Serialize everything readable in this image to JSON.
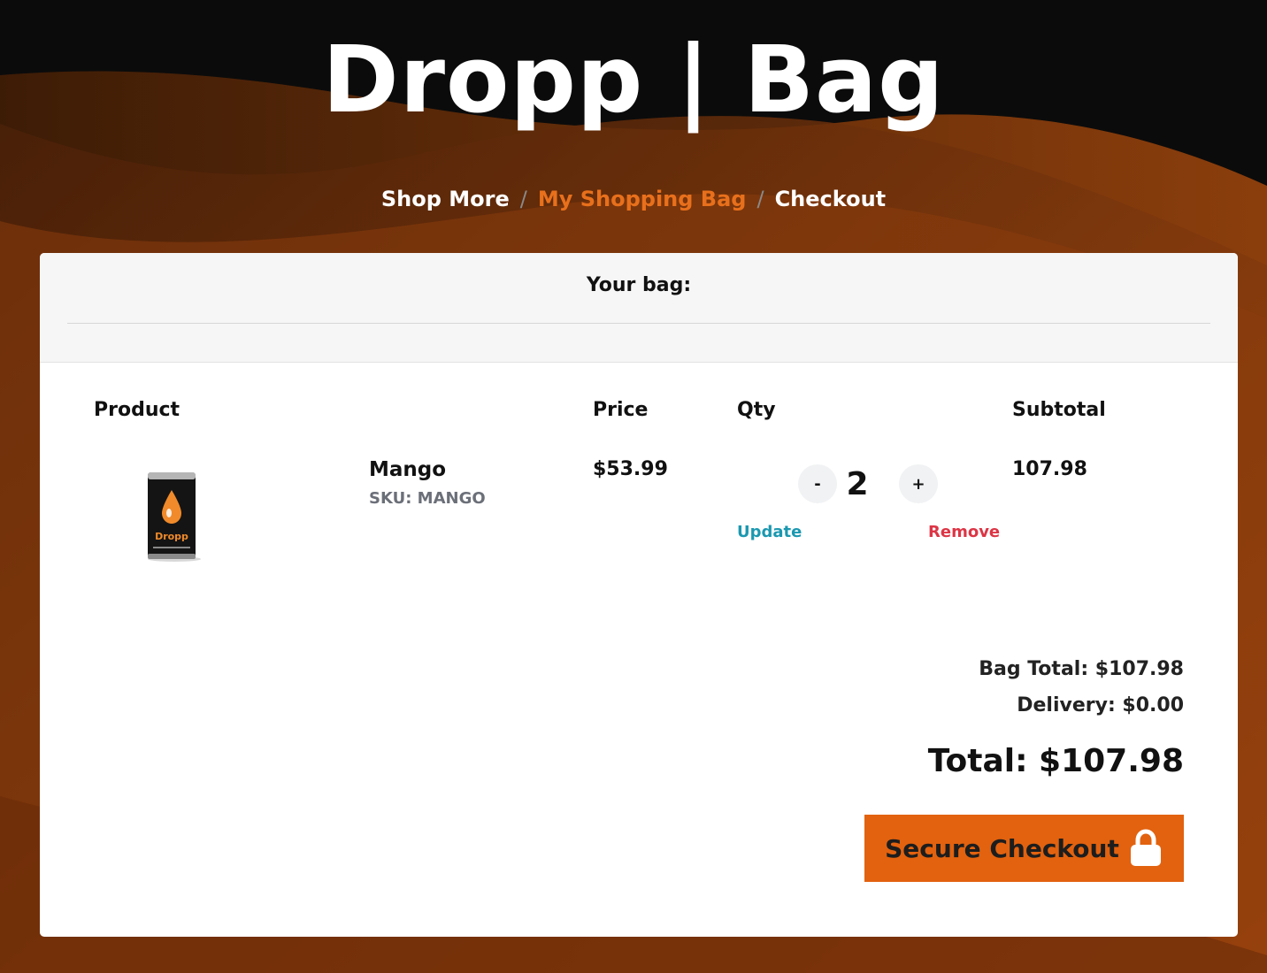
{
  "header": {
    "title": "Dropp | Bag"
  },
  "breadcrumb": {
    "items": [
      {
        "label": "Shop More",
        "active": false
      },
      {
        "label": "My Shopping Bag",
        "active": true
      },
      {
        "label": "Checkout",
        "active": false
      }
    ],
    "separator": "/"
  },
  "bag": {
    "heading": "Your bag:",
    "columns": {
      "product": "Product",
      "price": "Price",
      "qty": "Qty",
      "subtotal": "Subtotal"
    },
    "items": [
      {
        "name": "Mango",
        "sku": "SKU: MANGO",
        "image_brand_text": "Dropp",
        "price": "$53.99",
        "qty": "2",
        "decrease_label": "-",
        "increase_label": "+",
        "update_label": "Update",
        "remove_label": "Remove",
        "subtotal": "107.98"
      }
    ]
  },
  "totals": {
    "bag_total": "Bag Total: $107.98",
    "delivery": "Delivery: $0.00",
    "total": "Total: $107.98"
  },
  "checkout": {
    "label": "Secure Checkout",
    "icon": "lock-icon"
  },
  "colors": {
    "accent": "#e2620f",
    "breadcrumb_active": "#e8701c",
    "update_link": "#1b98b0",
    "remove_link": "#dc3545",
    "background_dark": "#0b0b0b",
    "background_orange": "#9a4610"
  }
}
